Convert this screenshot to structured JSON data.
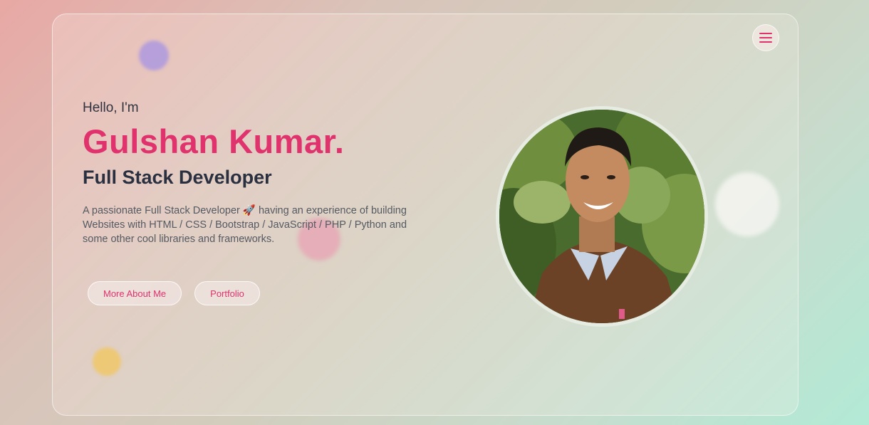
{
  "hero": {
    "greeting": "Hello, I'm",
    "name": "Gulshan Kumar.",
    "role": "Full Stack Developer",
    "description": "A passionate Full Stack Developer 🚀 having an experience of building Websites with HTML / CSS / Bootstrap / JavaScript / PHP / Python and some other cool libraries and frameworks."
  },
  "buttons": {
    "more_about": "More About Me",
    "portfolio": "Portfolio"
  },
  "icons": {
    "menu": "hamburger-menu-icon",
    "avatar": "profile-photo"
  },
  "colors": {
    "accent": "#e0336e",
    "text_dark": "#2a3040",
    "text_muted": "#555a62"
  }
}
